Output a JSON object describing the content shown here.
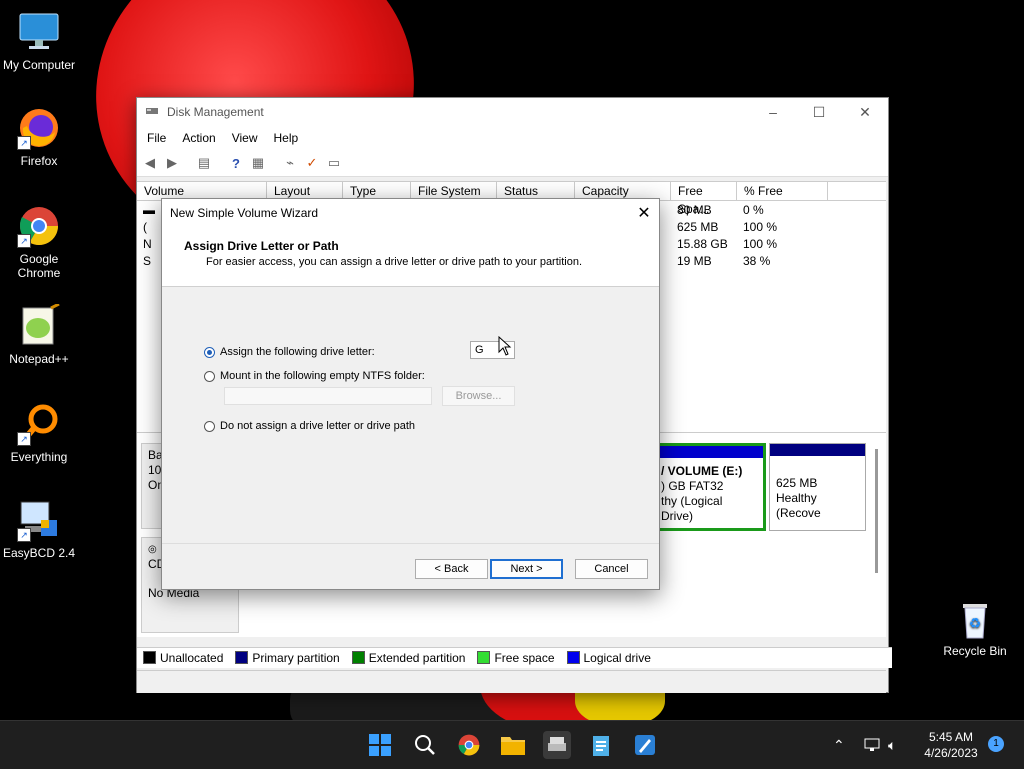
{
  "desktop": {
    "icons": [
      {
        "label": "My Computer",
        "icon": "monitor-icon"
      },
      {
        "label": "Firefox",
        "icon": "firefox-icon"
      },
      {
        "label": "Google Chrome",
        "icon": "chrome-icon"
      },
      {
        "label": "Notepad++",
        "icon": "notepadpp-icon"
      },
      {
        "label": "Everything",
        "icon": "everything-search-icon"
      },
      {
        "label": "EasyBCD 2.4",
        "icon": "easybcd-icon"
      },
      {
        "label": "Recycle Bin",
        "icon": "recycle-bin-icon"
      }
    ]
  },
  "disk_mgmt": {
    "title": "Disk Management",
    "menu": [
      "File",
      "Action",
      "View",
      "Help"
    ],
    "columns": [
      "Volume",
      "Layout",
      "Type",
      "File System",
      "Status",
      "Capacity",
      "Free Spa...",
      "% Free"
    ],
    "rows": [
      {
        "name": "",
        "free": "80 MB",
        "pct": "0 %"
      },
      {
        "name": "(",
        "free": "625 MB",
        "pct": "100 %"
      },
      {
        "name": "N",
        "free": "15.88 GB",
        "pct": "100 %"
      },
      {
        "name": "S",
        "free": "19 MB",
        "pct": "38 %"
      }
    ],
    "disk0": {
      "line1": "Bas",
      "line2": "100",
      "line3": "On"
    },
    "disk1": {
      "line1": "CD",
      "line2": "No Media"
    },
    "part_e": {
      "line1": "/ VOLUME  (E:)",
      "line2": ") GB FAT32",
      "line3": "thy (Logical Drive)"
    },
    "part_rec": {
      "line1": "625 MB",
      "line2": "Healthy (Recove"
    },
    "legend": [
      {
        "label": "Unallocated",
        "color": "#000000"
      },
      {
        "label": "Primary partition",
        "color": "#000080"
      },
      {
        "label": "Extended partition",
        "color": "#008000"
      },
      {
        "label": "Free space",
        "color": "#33dd33"
      },
      {
        "label": "Logical drive",
        "color": "#0000ee"
      }
    ]
  },
  "wizard": {
    "title": "New Simple Volume Wizard",
    "heading": "Assign Drive Letter or Path",
    "subheading": "For easier access, you can assign a drive letter or drive path to your partition.",
    "opt_letter": "Assign the following drive letter:",
    "letter_value": "G",
    "opt_mount": "Mount in the following empty NTFS folder:",
    "browse": "Browse...",
    "opt_none": "Do not assign a drive letter or drive path",
    "back": "< Back",
    "next": "Next >",
    "cancel": "Cancel"
  },
  "taskbar": {
    "time": "5:45 AM",
    "date": "4/26/2023",
    "notifications": "1"
  }
}
